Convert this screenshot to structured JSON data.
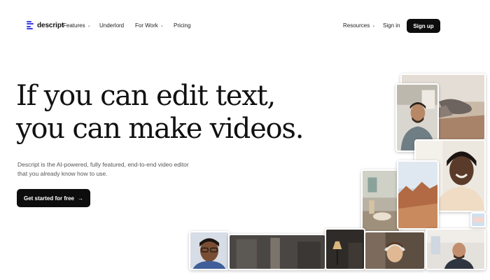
{
  "nav": {
    "logo": "descript",
    "features": "Features",
    "underlord": "Underlord",
    "for_work": "For Work",
    "pricing": "Pricing",
    "resources": "Resources",
    "sign_in": "Sign in",
    "sign_up": "Sign up"
  },
  "hero": {
    "headline_line1": "If you can edit text,",
    "headline_line2": "you can make videos.",
    "subtext_line1": "Descript is the AI-powered, fully featured, end-to-end video editor",
    "subtext_line2": "that you already know how to use.",
    "cta": "Get started for free",
    "cta_arrow": "→"
  },
  "colors": {
    "brand": "#3b3ee8",
    "button_dark": "#0d0d0d",
    "text": "#111111",
    "muted": "#555555"
  },
  "icons": {
    "chevron": "chevron-down-icon",
    "arrow": "arrow-right-icon",
    "logo": "descript-logo-icon"
  }
}
